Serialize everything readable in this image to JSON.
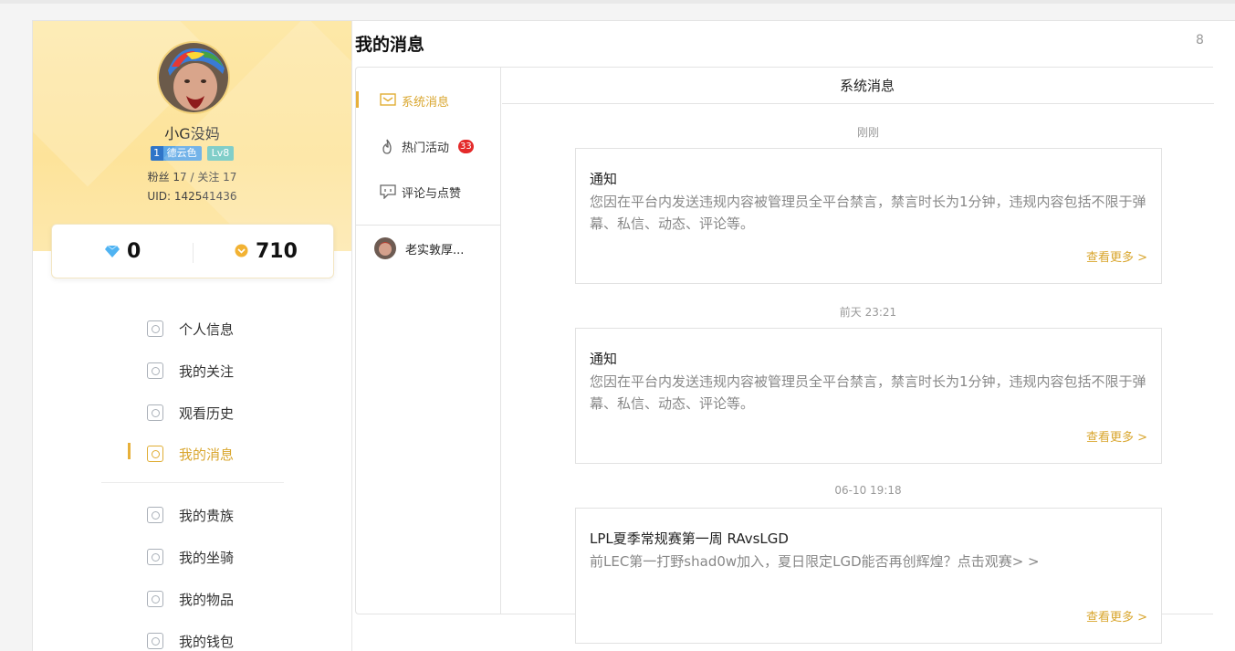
{
  "profile": {
    "username": "小G没妈",
    "guild_badge": "德云色",
    "guild_shield": "1",
    "level_badge": "Lv8",
    "fans_follow": "粉丝 17 / 关注 17",
    "uid": "UID: 142541436",
    "diamonds": "0",
    "coins": "710"
  },
  "menu": {
    "items": [
      {
        "label": "个人信息",
        "icon": "profile-card-icon"
      },
      {
        "label": "我的关注",
        "icon": "eye-icon"
      },
      {
        "label": "观看历史",
        "icon": "play-icon"
      },
      {
        "label": "我的消息",
        "icon": "message-icon",
        "active": true
      },
      {
        "label": "我的贵族",
        "icon": "crown-icon"
      },
      {
        "label": "我的坐骑",
        "icon": "horse-icon"
      },
      {
        "label": "我的物品",
        "icon": "package-icon"
      },
      {
        "label": "我的钱包",
        "icon": "wallet-icon"
      }
    ]
  },
  "main": {
    "title": "我的消息",
    "corner": "8",
    "categories": [
      {
        "label": "系统消息",
        "icon": "envelope-icon",
        "active": true
      },
      {
        "label": "热门活动",
        "icon": "flame-icon",
        "count": "33"
      },
      {
        "label": "评论与点赞",
        "icon": "comment-icon"
      }
    ],
    "contact": {
      "name": "老实敦厚..."
    },
    "header": "系统消息",
    "messages": [
      {
        "time": "刚刚",
        "title": "通知",
        "body": "您因在平台内发送违规内容被管理员全平台禁言，禁言时长为1分钟，违规内容包括不限于弹幕、私信、动态、评论等。",
        "more": "查看更多 >"
      },
      {
        "time": "前天 23:21",
        "title": "通知",
        "body": "您因在平台内发送违规内容被管理员全平台禁言，禁言时长为1分钟，违规内容包括不限于弹幕、私信、动态、评论等。",
        "more": "查看更多 >"
      },
      {
        "time": "06-10 19:18",
        "title": "LPL夏季常规赛第一周 RAvsLGD",
        "body": "前LEC第一打野shad0w加入，夏日限定LGD能否再创辉煌？点击观赛> >",
        "more": "查看更多 >"
      }
    ]
  },
  "colors": {
    "accent": "#e7b03a",
    "accent_text": "#d9a62e",
    "badge_red": "#e42a2a"
  }
}
